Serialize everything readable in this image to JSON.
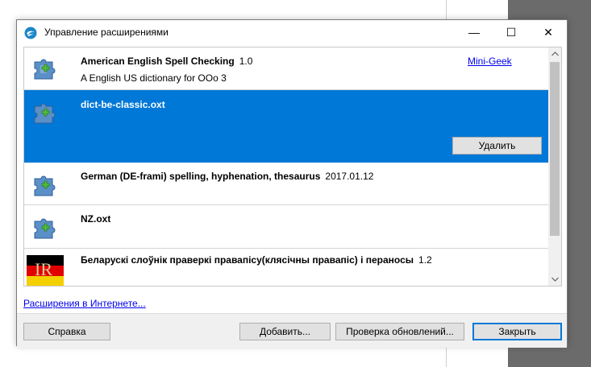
{
  "window": {
    "title": "Управление расширениями",
    "minimize": "—",
    "maximize": "☐",
    "close": "✕"
  },
  "extensions": [
    {
      "name": "American English Spell Checking",
      "version": "1.0",
      "description": "A English US dictionary for OOo 3",
      "author": "Mini-Geek",
      "icon": "puzzle-icon",
      "selected": false
    },
    {
      "name": "dict-be-classic.oxt",
      "version": "",
      "description": "",
      "author": "",
      "icon": "puzzle-icon",
      "selected": true,
      "action": "Удалить"
    },
    {
      "name": "German (DE-frami) spelling, hyphenation, thesaurus",
      "version": "2017.01.12",
      "description": "",
      "author": "",
      "icon": "puzzle-icon",
      "selected": false
    },
    {
      "name": "NZ.oxt",
      "version": "",
      "description": "",
      "author": "",
      "icon": "puzzle-icon",
      "selected": false
    },
    {
      "name": "Беларускі слоўнік праверкі правапісу(клясічны правапіс) і пераносы",
      "version": "1.2",
      "description": "",
      "author": "",
      "icon": "ir-flag-icon",
      "icon_text": "IR",
      "selected": false
    }
  ],
  "links": {
    "web": "Расширения в Интернете..."
  },
  "buttons": {
    "help": "Справка",
    "add": "Добавить...",
    "check_updates": "Проверка обновлений...",
    "close": "Закрыть"
  },
  "colors": {
    "selection": "#0078d7",
    "link": "#0000ee",
    "button_face": "#e1e1e1",
    "dialog_footer": "#f0f0f0"
  }
}
